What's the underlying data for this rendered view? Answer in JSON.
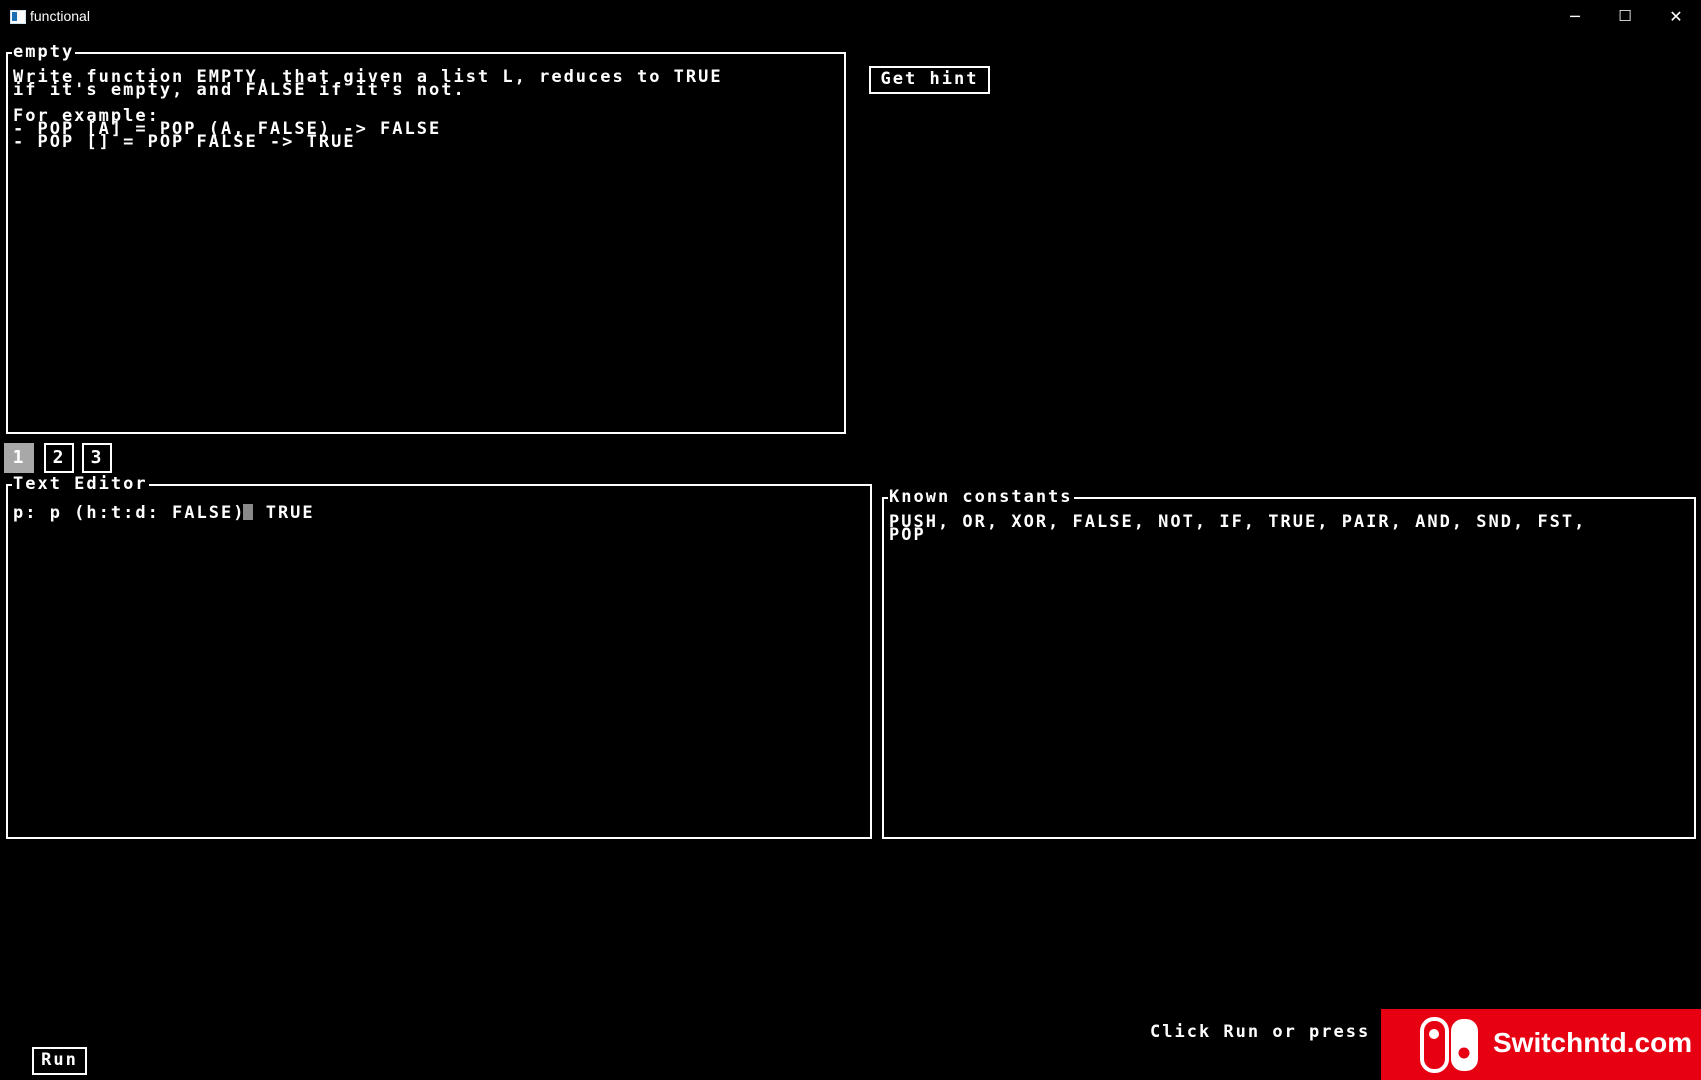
{
  "window": {
    "title": "functional",
    "controls": {
      "minimize": "─",
      "maximize": "☐",
      "close": "✕"
    }
  },
  "task": {
    "legend": "empty",
    "description": "Write function EMPTY, that given a list L, reduces to TRUE\nif it's empty, and FALSE if it's not.\n\nFor example:\n- POP [A] = POP (A, FALSE) -> FALSE\n- POP [] = POP FALSE -> TRUE"
  },
  "hint_button": "Get hint",
  "tabs": [
    {
      "label": "1",
      "active": true
    },
    {
      "label": "2",
      "active": false
    },
    {
      "label": "3",
      "active": false
    }
  ],
  "editor": {
    "legend": "Text Editor",
    "code_before_cursor": "p: p (h:t:d: FALSE)",
    "code_after_cursor": " TRUE"
  },
  "constants": {
    "legend": "Known constants",
    "text": "PUSH, OR, XOR, FALSE, NOT, IF, TRUE, PAIR, AND, SND, FST,\nPOP"
  },
  "run_button": "Run",
  "status": "Click Run or press",
  "watermark": {
    "text": "Switchntd.com",
    "accent": "#e60012"
  }
}
